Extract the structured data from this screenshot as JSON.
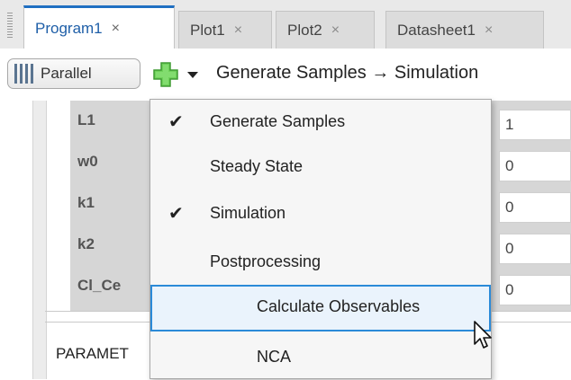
{
  "tabs": [
    {
      "label": "Program1",
      "close": "×"
    },
    {
      "label": "Plot1",
      "close": "×"
    },
    {
      "label": "Plot2",
      "close": "×"
    },
    {
      "label": "Datasheet1",
      "close": "×"
    }
  ],
  "toolbar": {
    "parallel_label": "Parallel",
    "pipeline_text": "Generate Samples → Simulation"
  },
  "parameters": {
    "rows": [
      {
        "name": "L1",
        "value": "1"
      },
      {
        "name": "w0",
        "value": "0"
      },
      {
        "name": "k1",
        "value": "0"
      },
      {
        "name": "k2",
        "value": "0"
      },
      {
        "name": "Cl_Ce",
        "value": "0"
      }
    ],
    "section_label": "PARAMET"
  },
  "menu": {
    "items": [
      {
        "label": "Generate Samples",
        "checked": true,
        "check": "✔"
      },
      {
        "label": "Steady State",
        "checked": false,
        "check": ""
      },
      {
        "label": "Simulation",
        "checked": true,
        "check": "✔"
      },
      {
        "label": "Postprocessing",
        "checked": false,
        "check": ""
      },
      {
        "label": "Calculate Observables",
        "checked": false,
        "check": "",
        "hovered": true
      },
      {
        "label": "NCA",
        "checked": false,
        "check": ""
      }
    ]
  },
  "colors": {
    "active_tab_accent": "#1f6fc2",
    "add_icon_green": "#5cc04a",
    "hover_border": "#2b8ad8"
  },
  "icons": {
    "parallel": "parallel-bars-icon",
    "add": "green-plus-icon",
    "dropdown": "chevron-down-icon",
    "cursor": "mouse-pointer-icon"
  }
}
